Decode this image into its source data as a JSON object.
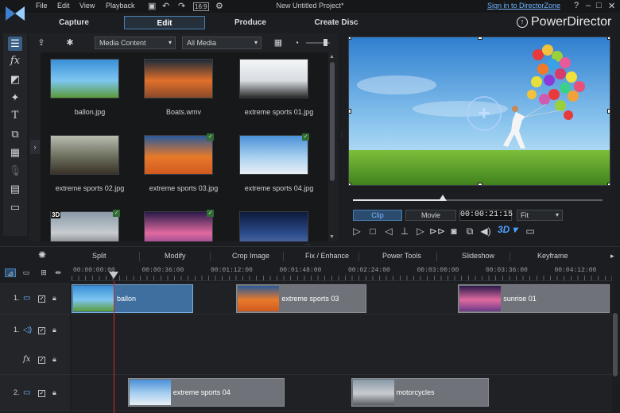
{
  "menu": [
    "File",
    "Edit",
    "View",
    "Playback"
  ],
  "window_title": "New Untitled Project*",
  "signin": "Sign in to DirectorZone",
  "window_buttons": [
    "?",
    "–",
    "□",
    "✕"
  ],
  "modes": [
    "Capture",
    "Edit",
    "Produce",
    "Create Disc"
  ],
  "active_mode": "Edit",
  "brand": "PowerDirector",
  "library": {
    "content_dropdown": "Media Content",
    "filter_dropdown": "All Media",
    "items": [
      {
        "label": "ballon.jpg",
        "colors": [
          "#3a8fd8",
          "#7ec6f0",
          "#5a9a3a"
        ]
      },
      {
        "label": "Boats.wmv",
        "colors": [
          "#1e2a3a",
          "#e0702a",
          "#8a4a2a"
        ]
      },
      {
        "label": "extreme sports 01.jpg",
        "colors": [
          "#f4f6f8",
          "#d8dde2",
          "#2a2a2a"
        ]
      },
      {
        "label": "extreme sports 02.jpg",
        "colors": [
          "#b8bcb0",
          "#6c6e5c",
          "#3a3228"
        ]
      },
      {
        "label": "extreme sports 03.jpg",
        "colors": [
          "#2a5a9a",
          "#e87a2a",
          "#d05a20"
        ]
      },
      {
        "label": "extreme sports 04.jpg",
        "colors": [
          "#4a90d8",
          "#a8d0f0",
          "#e8eef4"
        ]
      },
      {
        "label": "",
        "colors": [
          "#8a9aa8",
          "#c8ccd0",
          "#5a5e62"
        ]
      },
      {
        "label": "",
        "colors": [
          "#2a1a4a",
          "#e06aa0",
          "#6a3a8a"
        ]
      },
      {
        "label": "",
        "colors": [
          "#0e1a3a",
          "#2a4a8a",
          "#6a7ab0"
        ]
      }
    ]
  },
  "preview": {
    "tab_clip": "Clip",
    "tab_movie": "Movie",
    "timecode": "00:00:21:15",
    "fit": "Fit",
    "seek_progress": 0.36
  },
  "functions": [
    "Split",
    "Modify",
    "Crop Image",
    "Fix / Enhance",
    "Power Tools",
    "Slideshow",
    "Keyframe"
  ],
  "ruler": [
    "00:00:00:00",
    "00:00:36:00",
    "00:01:12:00",
    "00:01:48:00",
    "00:02:24:00",
    "00:03:00:00",
    "00:03:36:00",
    "00:04:12:00"
  ],
  "tracks": [
    {
      "num": "1.",
      "icon": "video-track-icon",
      "clips": [
        {
          "label": "ballon",
          "selected": true,
          "start": 0,
          "len": 0.225,
          "colors": [
            "#3a8fd8",
            "#7ec6f0",
            "#5a9a3a"
          ]
        },
        {
          "label": "extreme sports 03",
          "selected": false,
          "start": 0.305,
          "len": 0.24,
          "colors": [
            "#2a5a9a",
            "#e87a2a",
            "#d05a20"
          ]
        },
        {
          "label": "sunrise 01",
          "selected": false,
          "start": 0.715,
          "len": 0.28,
          "colors": [
            "#2a1a4a",
            "#e06aa0",
            "#6a3a8a"
          ]
        }
      ]
    },
    {
      "num": "1.",
      "icon": "audio-track-icon",
      "clips": []
    },
    {
      "num": "",
      "icon": "fx-track-icon",
      "clips": []
    },
    {
      "num": "2.",
      "icon": "video-track-icon",
      "clips": [
        {
          "label": "extreme sports 04",
          "selected": false,
          "start": 0.104,
          "len": 0.29,
          "colors": [
            "#4a90d8",
            "#a8d0f0",
            "#e8eef4"
          ]
        },
        {
          "label": "motorcycles",
          "selected": false,
          "start": 0.517,
          "len": 0.255,
          "colors": [
            "#8a9aa8",
            "#c8ccd0",
            "#5a5e62"
          ]
        }
      ]
    }
  ]
}
